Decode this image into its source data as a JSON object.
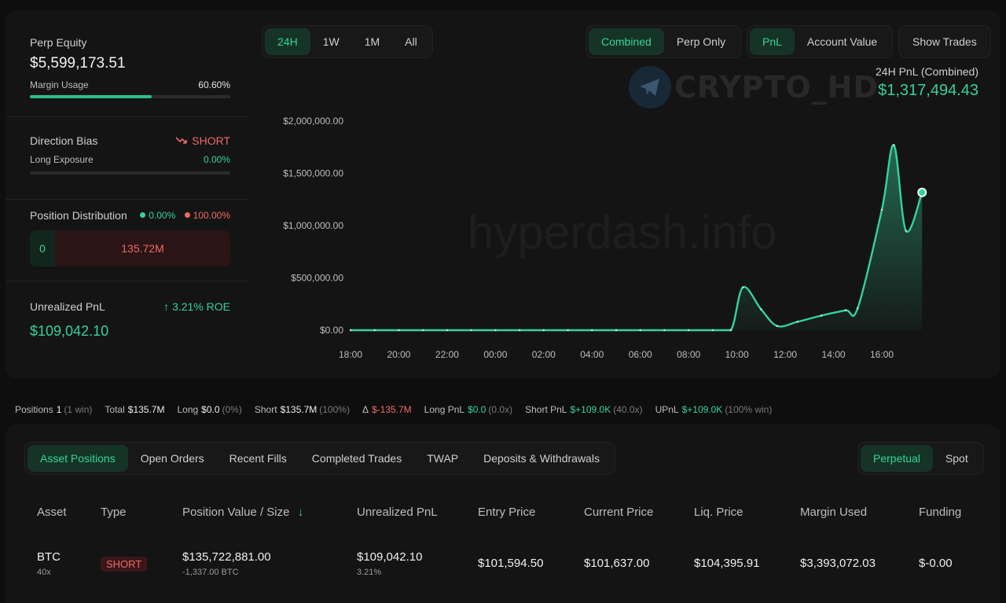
{
  "perp_equity": {
    "label": "Perp Equity",
    "value": "$5,599,173.51"
  },
  "margin_usage": {
    "label": "Margin Usage",
    "value": "60.60%",
    "fraction": 0.606
  },
  "direction_bias": {
    "label": "Direction Bias",
    "value": "SHORT"
  },
  "long_exposure": {
    "label": "Long Exposure",
    "value": "0.00%",
    "fraction": 0.0
  },
  "position_distribution": {
    "label": "Position Distribution",
    "long_pct": "0.00%",
    "short_pct": "100.00%",
    "long_value": "0",
    "short_value": "135.72M"
  },
  "unrealized_pnl": {
    "label": "Unrealized PnL",
    "roe": "3.21% ROE",
    "value": "$109,042.10"
  },
  "range_tabs": [
    {
      "label": "24H",
      "active": true
    },
    {
      "label": "1W",
      "active": false
    },
    {
      "label": "1M",
      "active": false
    },
    {
      "label": "All",
      "active": false
    }
  ],
  "mode_tabs": [
    {
      "label": "Combined",
      "active": true
    },
    {
      "label": "Perp Only",
      "active": false
    }
  ],
  "metric_tabs": [
    {
      "label": "PnL",
      "active": true
    },
    {
      "label": "Account Value",
      "active": false
    }
  ],
  "show_trades_label": "Show Trades",
  "pnl_summary": {
    "label": "24H PnL (Combined)",
    "value": "$1,317,494.43"
  },
  "watermarks": {
    "logo_text": "CRYPTO_HD",
    "site": "hyperdash.info"
  },
  "colors": {
    "accent": "#35d39a",
    "negative": "#ef6a67",
    "background": "#0e0e0e",
    "card": "#141414"
  },
  "chart_data": {
    "type": "area",
    "x": [
      "18:00",
      "19:00",
      "20:00",
      "21:00",
      "22:00",
      "23:00",
      "00:00",
      "01:00",
      "02:00",
      "03:00",
      "04:00",
      "05:00",
      "06:00",
      "07:00",
      "08:00",
      "09:00",
      "09:45",
      "10:15",
      "11:00",
      "11:40",
      "12:30",
      "13:30",
      "14:30",
      "15:00",
      "16:00",
      "16:30",
      "17:00",
      "17:40"
    ],
    "values": [
      0,
      0,
      0,
      0,
      0,
      0,
      0,
      0,
      0,
      0,
      0,
      0,
      0,
      0,
      0,
      0,
      0,
      410000,
      200000,
      40000,
      80000,
      140000,
      190000,
      210000,
      1150000,
      1770000,
      950000,
      1317494.43
    ],
    "x_ticks": [
      "18:00",
      "20:00",
      "22:00",
      "00:00",
      "02:00",
      "04:00",
      "06:00",
      "08:00",
      "10:00",
      "12:00",
      "14:00",
      "16:00"
    ],
    "y_ticks": [
      "$0.00",
      "$500,000.00",
      "$1,000,000.00",
      "$1,500,000.00",
      "$2,000,000.00"
    ],
    "ylim": [
      0,
      2000000
    ],
    "xlabel": "",
    "ylabel": "",
    "grid": false,
    "color": "#35d39a"
  },
  "stats": [
    {
      "k": "Positions",
      "v": "1",
      "m": "(1 win)",
      "color": "default"
    },
    {
      "k": "Total",
      "v": "$135.7M",
      "m": "",
      "color": "default"
    },
    {
      "k": "Long",
      "v": "$0.0",
      "m": "(0%)",
      "color": "default"
    },
    {
      "k": "Short",
      "v": "$135.7M",
      "m": "(100%)",
      "color": "default"
    },
    {
      "k": "Δ",
      "v": "$-135.7M",
      "m": "",
      "color": "red"
    },
    {
      "k": "Long PnL",
      "v": "$0.0",
      "m": "(0.0x)",
      "color": "green"
    },
    {
      "k": "Short PnL",
      "v": "$+109.0K",
      "m": "(40.0x)",
      "color": "green"
    },
    {
      "k": "UPnL",
      "v": "$+109.0K",
      "m": "(100% win)",
      "color": "green"
    }
  ],
  "bottom_tabs": [
    {
      "label": "Asset Positions",
      "active": true
    },
    {
      "label": "Open Orders",
      "active": false
    },
    {
      "label": "Recent Fills",
      "active": false
    },
    {
      "label": "Completed Trades",
      "active": false
    },
    {
      "label": "TWAP",
      "active": false
    },
    {
      "label": "Deposits & Withdrawals",
      "active": false
    }
  ],
  "market_tabs": [
    {
      "label": "Perpetual",
      "active": true
    },
    {
      "label": "Spot",
      "active": false
    }
  ],
  "table": {
    "headers": [
      "Asset",
      "Type",
      "Position Value / Size",
      "Unrealized PnL",
      "Entry Price",
      "Current Price",
      "Liq. Price",
      "Margin Used",
      "Funding"
    ],
    "row": {
      "asset": "BTC",
      "leverage": "40x",
      "type": "SHORT",
      "position_value": "$135,722,881.00",
      "position_size": "-1,337.00 BTC",
      "upnl": "$109,042.10",
      "upnl_pct": "3.21%",
      "entry": "$101,594.50",
      "current": "$101,637.00",
      "liq": "$104,395.91",
      "margin": "$3,393,072.03",
      "funding": "$-0.00"
    }
  }
}
